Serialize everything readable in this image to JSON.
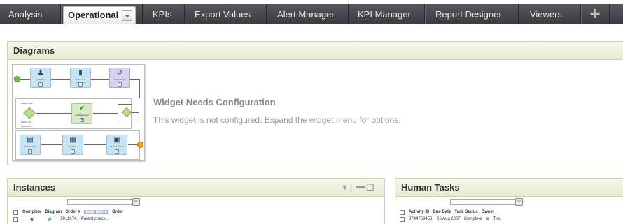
{
  "nav": {
    "tabs": [
      {
        "label": "Analysis"
      },
      {
        "label": "Operational"
      },
      {
        "label": "KPIs"
      },
      {
        "label": "Export Values"
      },
      {
        "label": "Alert Manager"
      },
      {
        "label": "KPI Manager"
      },
      {
        "label": "Report Designer"
      },
      {
        "label": "Viewers"
      }
    ],
    "active_tab": "Operational",
    "add_tab_icon": "plus-icon",
    "active_dropdown_icon": "chevron-down-icon"
  },
  "diagrams": {
    "title": "Diagrams",
    "message_title": "Widget Needs Configuration",
    "message_body": "This widget is not configured. Expand the widget menu for options.",
    "thumbnail": {
      "nodes": [
        "Application",
        "Document Processing",
        "Credit Check",
        "Final Approval",
        "Underwriting",
        "Funding",
        "Record Initiate"
      ],
      "annotations": [
        "Mo.No. Cha.",
        "Mo.No. Per",
        "Approval ?"
      ]
    }
  },
  "instances": {
    "title": "Instances",
    "columns": [
      "Complete",
      "Diagram",
      "Order #",
      "Task Name",
      "Order"
    ],
    "highlight_column": "Task Name",
    "rows": [
      {
        "order": "5011674.",
        "task": "Patent check..."
      }
    ]
  },
  "human_tasks": {
    "title": "Human Tasks",
    "columns": [
      "Activity ID",
      "Due Date",
      "Task Status",
      "Owner"
    ],
    "rows": [
      {
        "activity_id": "3744759453.",
        "due_date": "26 Aug 2007",
        "status": "Complete",
        "owner": "Tim."
      }
    ]
  },
  "colors": {
    "nav_bg": "#4a4a4e",
    "panel_header": "#e9f0dc",
    "panel_border": "#c9d6b3",
    "node_fill": "#c8e3f2"
  }
}
